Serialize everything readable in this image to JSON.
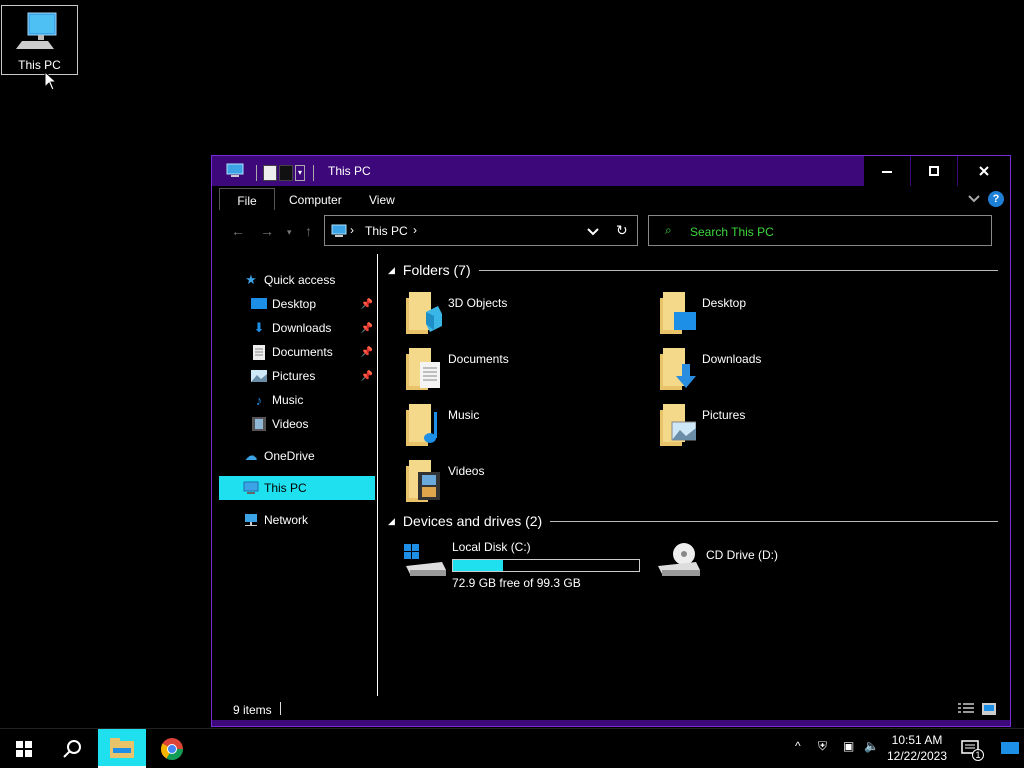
{
  "desktop": {
    "icon_label": "This PC"
  },
  "window": {
    "title": "This PC",
    "ribbon_tabs": {
      "file": "File",
      "computer": "Computer",
      "view": "View"
    },
    "help": "?",
    "address": {
      "crumb": "This PC"
    },
    "search": {
      "placeholder": "Search This PC"
    },
    "nav": {
      "quick_access": "Quick access",
      "desktop": "Desktop",
      "downloads": "Downloads",
      "documents": "Documents",
      "pictures": "Pictures",
      "music": "Music",
      "videos": "Videos",
      "onedrive": "OneDrive",
      "this_pc": "This PC",
      "network": "Network"
    },
    "groups": {
      "folders": "Folders (7)",
      "devices": "Devices and drives (2)"
    },
    "folders": {
      "f1": "3D Objects",
      "f2": "Desktop",
      "f3": "Documents",
      "f4": "Downloads",
      "f5": "Music",
      "f6": "Pictures",
      "f7": "Videos"
    },
    "drives": {
      "c_name": "Local Disk (C:)",
      "c_free": "72.9 GB free of 99.3 GB",
      "c_used_fraction": 0.27,
      "d_name": "CD Drive (D:)"
    },
    "status": {
      "count": "9 items"
    }
  },
  "taskbar": {
    "time": "10:51 AM",
    "date": "12/22/2023",
    "notif_count": "1"
  },
  "colors": {
    "accent": "#1ee0ee",
    "titlebar": "#3d087a",
    "search_text": "#3cd63c"
  }
}
